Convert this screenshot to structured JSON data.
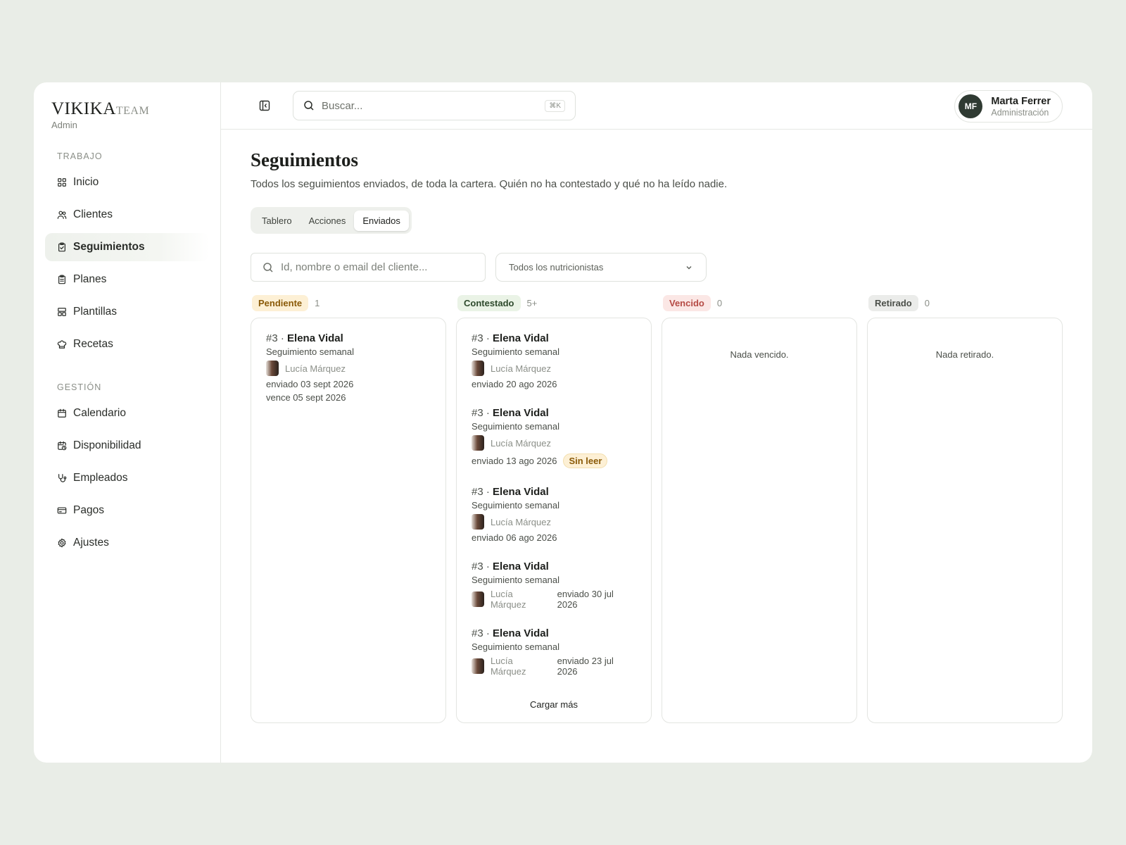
{
  "brand": {
    "name": "VIKIKA",
    "suffix": "TEAM",
    "subtitle": "Admin"
  },
  "sidebar": {
    "sections": [
      {
        "label": "TRABAJO",
        "items": [
          "Inicio",
          "Clientes",
          "Seguimientos",
          "Planes",
          "Plantillas",
          "Recetas"
        ]
      },
      {
        "label": "GESTIÓN",
        "items": [
          "Calendario",
          "Disponibilidad",
          "Empleados",
          "Pagos",
          "Ajustes"
        ]
      }
    ],
    "active": "Seguimientos"
  },
  "topbar": {
    "search_placeholder": "Buscar...",
    "shortcut": "⌘K"
  },
  "user": {
    "initials": "MF",
    "name": "Marta Ferrer",
    "role": "Administración"
  },
  "page": {
    "title": "Seguimientos",
    "description": "Todos los seguimientos enviados, de toda la cartera. Quién no ha contestado y qué no ha leído nadie.",
    "tabs": [
      "Tablero",
      "Acciones",
      "Enviados"
    ],
    "active_tab": "Enviados"
  },
  "filters": {
    "search_placeholder": "Id, nombre o email del cliente...",
    "select_value": "Todos los nutricionistas"
  },
  "columns": [
    {
      "label": "Pendiente",
      "count": "1",
      "color": "#8a5a08",
      "bg": "#fdf0d5",
      "cards": [
        {
          "num": "#3",
          "name": "Elena Vidal",
          "type": "Seguimiento semanal",
          "person": "Lucía Márquez",
          "lines": [
            "enviado 03 sept 2026",
            "vence 05 sept 2026"
          ]
        }
      ]
    },
    {
      "label": "Contestado",
      "count": "5+",
      "color": "#2e4a2c",
      "bg": "#eaf3e6",
      "cards": [
        {
          "num": "#3",
          "name": "Elena Vidal",
          "type": "Seguimiento semanal",
          "person": "Lucía Márquez",
          "lines": [
            "enviado 20 ago 2026"
          ]
        },
        {
          "num": "#3",
          "name": "Elena Vidal",
          "type": "Seguimiento semanal",
          "person": "Lucía Márquez",
          "lines": [
            "enviado 13 ago 2026"
          ],
          "unread": "Sin leer"
        },
        {
          "num": "#3",
          "name": "Elena Vidal",
          "type": "Seguimiento semanal",
          "person": "Lucía Márquez",
          "lines": [
            "enviado 06 ago 2026"
          ]
        },
        {
          "num": "#3",
          "name": "Elena Vidal",
          "type": "Seguimiento semanal",
          "person": "Lucía Márquez",
          "inline": "enviado 30 jul 2026"
        },
        {
          "num": "#3",
          "name": "Elena Vidal",
          "type": "Seguimiento semanal",
          "person": "Lucía Márquez",
          "inline": "enviado 23 jul 2026"
        }
      ],
      "load_more": "Cargar más"
    },
    {
      "label": "Vencido",
      "count": "0",
      "color": "#b54a44",
      "bg": "#fbe7e5",
      "empty": "Nada vencido.",
      "cards": []
    },
    {
      "label": "Retirado",
      "count": "0",
      "color": "#4b4f49",
      "bg": "#ebecea",
      "empty": "Nada retirado.",
      "cards": []
    }
  ],
  "icons": {
    "Inicio": "grid-icon",
    "Clientes": "users-icon",
    "Seguimientos": "clipboard-check-icon",
    "Planes": "clipboard-icon",
    "Plantillas": "layout-icon",
    "Recetas": "chef-hat-icon",
    "Calendario": "calendar-icon",
    "Disponibilidad": "calendar-clock-icon",
    "Empleados": "stethoscope-icon",
    "Pagos": "credit-card-icon",
    "Ajustes": "gear-icon"
  }
}
